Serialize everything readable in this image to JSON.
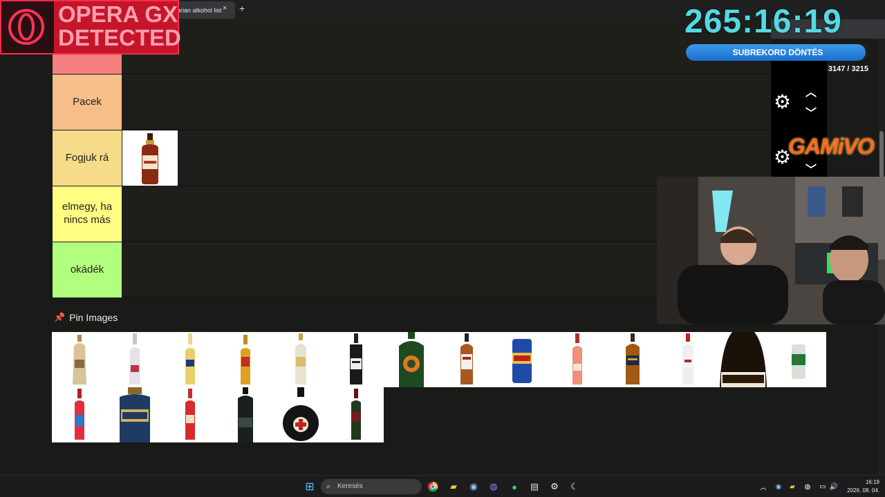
{
  "browser": {
    "tab_title": "arian alkohol list",
    "url": "hol-list-15783425",
    "new_tab_symbol": "+",
    "close_symbol": "×"
  },
  "tiers": [
    {
      "label": "",
      "color": "#f47f7f"
    },
    {
      "label": "Pacek",
      "color": "#f6be88"
    },
    {
      "label": "Fogjuk rá",
      "color": "#f6dc88"
    },
    {
      "label": "elmegy, ha nincs más",
      "color": "#fffe82"
    },
    {
      "label": "okádék",
      "color": "#b2ff7f"
    }
  ],
  "pin_images": {
    "title": "Pin Images"
  },
  "overlays": {
    "opera_text": "OPERA GX DETECTED",
    "timer": "265:16:19",
    "subrecord_label": "SUBREKORD DÖNTÉS",
    "sub_count": "3147 / 3215",
    "sub_progress": 0.979,
    "sponsor": "GAMiVO"
  },
  "taskbar": {
    "search_placeholder": "Keresés",
    "time": "16:19",
    "date": "2026. 08. 04."
  },
  "colors": {
    "page_bg": "#1a1a18",
    "timer": "#53d9e3",
    "opera_red": "#c4152b",
    "progress_blue": "#2b86dc"
  }
}
